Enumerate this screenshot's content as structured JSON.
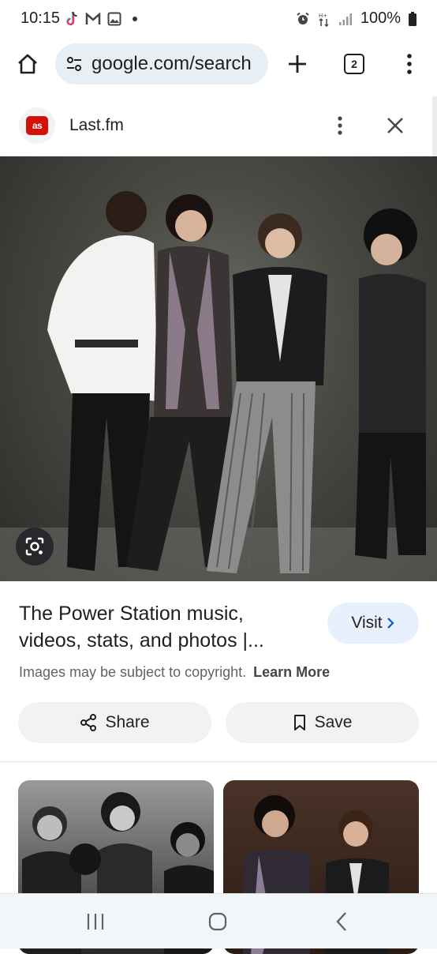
{
  "status_bar": {
    "time": "10:15",
    "battery": "100%",
    "icons_left": [
      "tiktok-icon",
      "gmail-icon",
      "gallery-icon",
      "dot"
    ],
    "icons_right": [
      "alarm-icon",
      "data-arrows-icon",
      "signal-icon",
      "battery-icon"
    ]
  },
  "browser": {
    "url": "google.com/search",
    "tab_count": "2"
  },
  "panel": {
    "source_logo_text": "as",
    "source_name": "Last.fm",
    "title": "The Power Station music, videos, stats, and photos |...",
    "visit_label": "Visit",
    "copyright_text": "Images may be subject to copyright.",
    "learn_more_label": "Learn More",
    "share_label": "Share",
    "save_label": "Save"
  },
  "colors": {
    "omnibox_bg": "#e7eef4",
    "visit_bg": "#e8f0fe",
    "lastfm_red": "#d51007",
    "action_bg": "#f0f2f3"
  }
}
